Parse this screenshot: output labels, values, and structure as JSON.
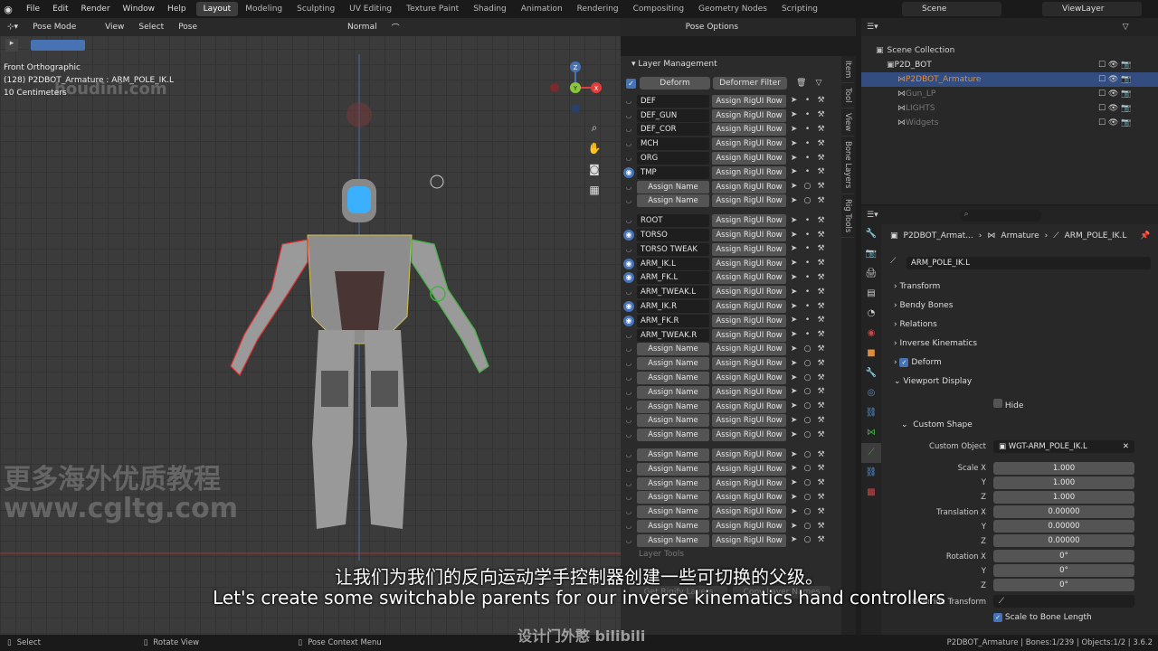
{
  "menu": [
    "File",
    "Edit",
    "Render",
    "Window",
    "Help"
  ],
  "workspaces": [
    "Layout",
    "Modeling",
    "Sculpting",
    "UV Editing",
    "Texture Paint",
    "Shading",
    "Animation",
    "Rendering",
    "Compositing",
    "Geometry Nodes",
    "Scripting"
  ],
  "scene": "Scene",
  "view_layer": "ViewLayer",
  "viewport_header": {
    "mode": "Pose Mode",
    "items": [
      "View",
      "Select",
      "Pose"
    ],
    "orientation": "Normal",
    "pose_options": "Pose Options"
  },
  "viewport_info": {
    "line1": "Front Orthographic",
    "line2": "(128) P2DBOT_Armature : ARM_POLE_IK.L",
    "line3": "10 Centimeters"
  },
  "gizmo": {
    "z": "Z",
    "y": "Y",
    "x": "X"
  },
  "layer_panel": {
    "title": "Layer Management",
    "deform_btn": "Deform",
    "filter_btn": "Deformer Filter",
    "assign_label": "Assign RigUI Row",
    "group1": [
      {
        "name": "DEF",
        "eye": false,
        "empty": false
      },
      {
        "name": "DEF_GUN",
        "eye": false,
        "empty": false
      },
      {
        "name": "DEF_COR",
        "eye": false,
        "empty": false
      },
      {
        "name": "MCH",
        "eye": false,
        "empty": false
      },
      {
        "name": "ORG",
        "eye": false,
        "empty": false
      },
      {
        "name": "TMP",
        "eye": true,
        "empty": false
      },
      {
        "name": "Assign Name",
        "eye": false,
        "empty": true
      },
      {
        "name": "Assign Name",
        "eye": false,
        "empty": true
      }
    ],
    "group2": [
      {
        "name": "ROOT",
        "eye": false,
        "empty": false
      },
      {
        "name": "TORSO",
        "eye": true,
        "empty": false
      },
      {
        "name": "TORSO TWEAK",
        "eye": false,
        "empty": false
      },
      {
        "name": "ARM_IK.L",
        "eye": true,
        "empty": false
      },
      {
        "name": "ARM_FK.L",
        "eye": true,
        "empty": false
      },
      {
        "name": "ARM_TWEAK.L",
        "eye": false,
        "empty": false
      },
      {
        "name": "ARM_IK.R",
        "eye": true,
        "empty": false
      },
      {
        "name": "ARM_FK.R",
        "eye": true,
        "empty": false
      },
      {
        "name": "ARM_TWEAK.R",
        "eye": false,
        "empty": false
      },
      {
        "name": "Assign Name",
        "eye": false,
        "empty": true
      },
      {
        "name": "Assign Name",
        "eye": false,
        "empty": true
      },
      {
        "name": "Assign Name",
        "eye": false,
        "empty": true
      },
      {
        "name": "Assign Name",
        "eye": false,
        "empty": true
      },
      {
        "name": "Assign Name",
        "eye": false,
        "empty": true
      },
      {
        "name": "Assign Name",
        "eye": false,
        "empty": true
      },
      {
        "name": "Assign Name",
        "eye": false,
        "empty": true
      }
    ],
    "group3": [
      {
        "name": "Assign Name",
        "eye": false,
        "empty": true
      },
      {
        "name": "Assign Name",
        "eye": false,
        "empty": true
      },
      {
        "name": "Assign Name",
        "eye": false,
        "empty": true
      },
      {
        "name": "Assign Name",
        "eye": false,
        "empty": true
      },
      {
        "name": "Assign Name",
        "eye": false,
        "empty": true
      },
      {
        "name": "Assign Name",
        "eye": false,
        "empty": true
      },
      {
        "name": "Assign Name",
        "eye": false,
        "empty": true
      }
    ],
    "layer_tools": "Layer Tools",
    "get_rigify": "Get Rigify Layers",
    "copy_names": "Copy Layer Names"
  },
  "side_tabs": [
    "Item",
    "Tool",
    "View",
    "Bone Layers",
    "Rig Tools"
  ],
  "outliner": {
    "root": "Scene Collection",
    "items": [
      {
        "name": "P2D_BOT",
        "indent": 1,
        "selected": false,
        "dim": false
      },
      {
        "name": "P2DBOT_Armature",
        "indent": 2,
        "selected": true,
        "dim": false
      },
      {
        "name": "Gun_LP",
        "indent": 2,
        "selected": false,
        "dim": true
      },
      {
        "name": "LIGHTS",
        "indent": 2,
        "selected": false,
        "dim": true
      },
      {
        "name": "Widgets",
        "indent": 2,
        "selected": false,
        "dim": true
      }
    ]
  },
  "properties": {
    "breadcrumb": [
      "P2DBOT_Armat...",
      "Armature",
      "ARM_POLE_IK.L"
    ],
    "bone_name": "ARM_POLE_IK.L",
    "panels": [
      "Transform",
      "Bendy Bones",
      "Relations",
      "Inverse Kinematics",
      "Deform",
      "Viewport Display"
    ],
    "hide": "Hide",
    "custom_shape": "Custom Shape",
    "custom_object_label": "Custom Object",
    "custom_object_value": "WGT-ARM_POLE_IK.L",
    "scale_label": "Scale X",
    "scale": [
      "1.000",
      "1.000",
      "1.000"
    ],
    "translation_label": "Translation X",
    "translation": [
      "0.00000",
      "0.00000",
      "0.00000"
    ],
    "rotation_label": "Rotation X",
    "rotation": [
      "0°",
      "0°",
      "0°"
    ],
    "y": "Y",
    "z": "Z",
    "override_transform": "Override Transform",
    "scale_to_bone": "Scale to Bone Length"
  },
  "status": {
    "select": "Select",
    "rotate": "Rotate View",
    "context": "Pose Context Menu",
    "right": "P2DBOT_Armature | Bones:1/239 | Objects:1/2 | 3.6.2"
  },
  "subtitle": {
    "cn": "让我们为我们的反向运动学手控制器创建一些可切换的父级。",
    "en": "Let's create some switchable parents for our inverse kinematics hand controllers"
  },
  "watermark": {
    "cn": "更多海外优质教程",
    "url": "www.cgltg.com",
    "houdini": "houdini.com",
    "bottom": "设计门外憨 bilibili"
  },
  "colors": {
    "accent": "#4772b3",
    "selected_row": "#334d80",
    "orange": "#e08b3b"
  }
}
